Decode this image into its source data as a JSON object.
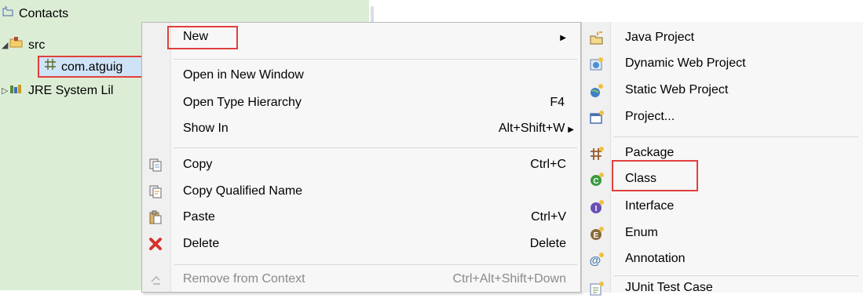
{
  "tree": {
    "project": {
      "label": "Contacts",
      "icon": "java-project-icon"
    },
    "src": {
      "label": "src",
      "icon": "source-folder-icon"
    },
    "package": {
      "label": "com.atguig",
      "icon": "package-icon",
      "selected": true
    },
    "jre": {
      "label": "JRE System Lil",
      "icon": "library-icon"
    }
  },
  "context_menu": {
    "new": {
      "label": "New",
      "has_submenu": true
    },
    "open_new_window": {
      "label": "Open in New Window"
    },
    "open_type_hierarchy": {
      "label": "Open Type Hierarchy",
      "shortcut": "F4"
    },
    "show_in": {
      "label": "Show In",
      "shortcut": "Alt+Shift+W",
      "has_submenu": true
    },
    "copy": {
      "label": "Copy",
      "shortcut": "Ctrl+C"
    },
    "copy_qualified": {
      "label": "Copy Qualified Name"
    },
    "paste": {
      "label": "Paste",
      "shortcut": "Ctrl+V"
    },
    "delete": {
      "label": "Delete",
      "shortcut": "Delete"
    },
    "remove_from_context": {
      "label": "Remove from Context",
      "shortcut": "Ctrl+Alt+Shift+Down",
      "disabled": true
    }
  },
  "submenu": {
    "items": [
      {
        "label": "Java Project",
        "icon": "java-project-icon"
      },
      {
        "label": "Dynamic Web Project",
        "icon": "dynamic-web-project-icon"
      },
      {
        "label": "Static Web Project",
        "icon": "static-web-project-icon"
      },
      {
        "label": "Project...",
        "icon": "project-icon"
      },
      {
        "label": "Package",
        "icon": "package-icon"
      },
      {
        "label": "Class",
        "icon": "class-icon",
        "highlighted": true
      },
      {
        "label": "Interface",
        "icon": "interface-icon"
      },
      {
        "label": "Enum",
        "icon": "enum-icon"
      },
      {
        "label": "Annotation",
        "icon": "annotation-icon"
      },
      {
        "label": "JUnit Test Case",
        "icon": "junit-icon"
      }
    ]
  },
  "colors": {
    "tree_background": "#dcedd6",
    "menu_background": "#f7f7f7",
    "highlight_border": "#e0403c"
  }
}
